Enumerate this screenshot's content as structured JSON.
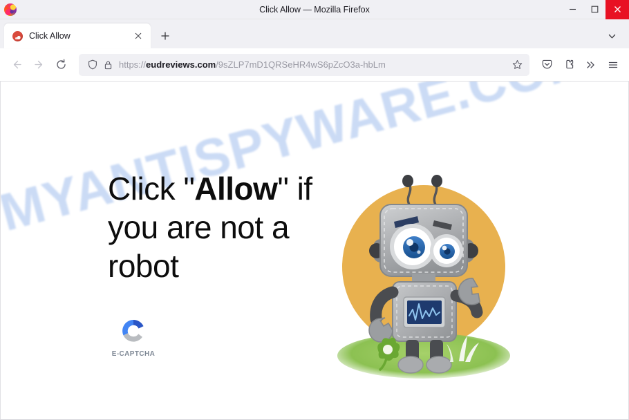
{
  "window": {
    "title": "Click Allow — Mozilla Firefox",
    "app_logo_icon": "firefox-logo",
    "controls": {
      "minimize_icon": "minimize-icon",
      "maximize_icon": "maximize-icon",
      "close_icon": "close-icon",
      "close_bg": "#e81123"
    }
  },
  "tabstrip": {
    "tabs": [
      {
        "title": "Click Allow",
        "favicon_icon": "page-favicon",
        "close_icon": "tab-close-icon"
      }
    ],
    "new_tab_icon": "plus-icon",
    "list_all_tabs_icon": "chevron-down-icon"
  },
  "navbar": {
    "back_icon": "arrow-left-icon",
    "forward_icon": "arrow-right-icon",
    "reload_icon": "reload-icon",
    "shield_icon": "shield-icon",
    "lock_icon": "lock-icon",
    "url_scheme": "https://",
    "url_host": "eudreviews.com",
    "url_path": "/9sZLP7mD1QRSeHR4wS6pZcO3a-hbLm",
    "url_full": "https://eudreviews.com/9sZLP7mD1QRSeHR4wS6pZcO3a-hbLm",
    "bookmark_icon": "star-icon",
    "pocket_icon": "pocket-icon",
    "extensions_icon": "extensions-icon",
    "overflow_icon": "double-chevron-icon",
    "menu_icon": "hamburger-menu-icon"
  },
  "page": {
    "watermark_text": "MYANTISPYWARE.COM",
    "watermark_color": "#cbdbf5",
    "headline_prefix": "Click \"",
    "headline_emphasis": "Allow",
    "headline_suffix": "\" if you are not a robot",
    "captcha": {
      "label": "E-CAPTCHA",
      "logo_icon": "e-captcha-c-logo",
      "color_primary": "#4285f4",
      "color_secondary": "#2a56c6",
      "color_muted": "#b9bcc0"
    },
    "illustration": {
      "name": "robot-mascot-illustration",
      "circle_color": "#e8b14f",
      "grass_color": "#8cc152",
      "body_color": "#a8aaad",
      "eye_color": "#1f5fa8",
      "screen_color": "#1e3a6e"
    }
  }
}
